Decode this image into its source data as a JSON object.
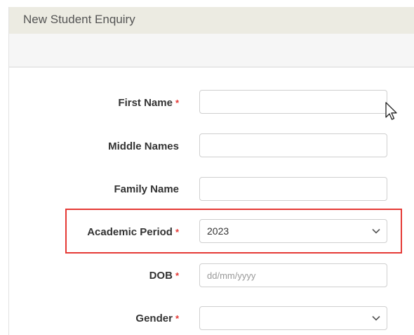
{
  "panel": {
    "title": "New Student Enquiry"
  },
  "form": {
    "required_marker": "*",
    "first_name": {
      "label": "First Name",
      "value": "",
      "required": true
    },
    "middle_names": {
      "label": "Middle Names",
      "value": "",
      "required": false
    },
    "family_name": {
      "label": "Family Name",
      "value": "",
      "required": false
    },
    "academic_period": {
      "label": "Academic Period",
      "selected": "2023",
      "required": true
    },
    "dob": {
      "label": "DOB",
      "placeholder": "dd/mm/yyyy",
      "required": true
    },
    "gender": {
      "label": "Gender",
      "selected": "",
      "required": true
    }
  },
  "annotation": {
    "highlight_color": "#e53935",
    "highlighted_field": "academic_period"
  },
  "icons": {
    "select_arrow": "chevron-down-icon",
    "cursor": "mouse-pointer-icon"
  }
}
